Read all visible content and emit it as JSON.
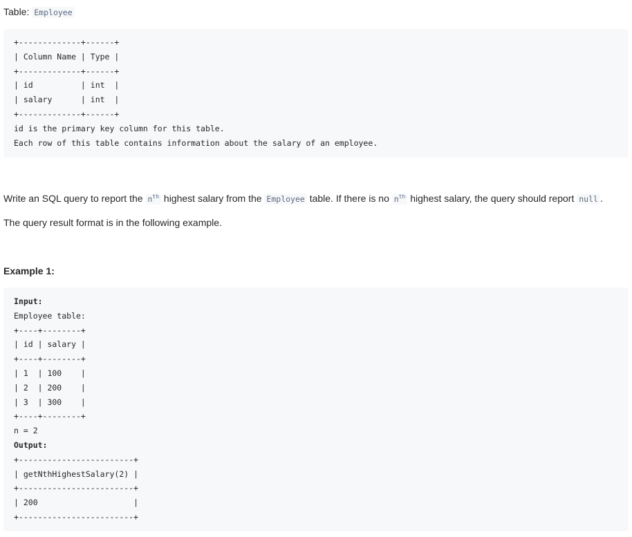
{
  "table_label": {
    "prefix": "Table: ",
    "name": "Employee"
  },
  "schema_block": {
    "lines": [
      "+-------------+------+",
      "| Column Name | Type |",
      "+-------------+------+",
      "| id          | int  |",
      "| salary      | int  |",
      "+-------------+------+",
      "id is the primary key column for this table.",
      "Each row of this table contains information about the salary of an employee."
    ]
  },
  "description": {
    "p1_a": "Write an SQL query to report the ",
    "n1": "n",
    "sup1": "th",
    "p1_b": " highest salary from the ",
    "table_code": "Employee",
    "p1_c": " table. If there is no ",
    "n2": "n",
    "sup2": "th",
    "p1_d": " highest salary, the query should report ",
    "null_code": "null",
    "p1_e": ".",
    "p2": "The query result format is in the following example."
  },
  "example": {
    "heading": "Example 1:",
    "input_label": "Input:",
    "input_lines": [
      "Employee table:",
      "+----+--------+",
      "| id | salary |",
      "+----+--------+",
      "| 1  | 100    |",
      "| 2  | 200    |",
      "| 3  | 300    |",
      "+----+--------+",
      "n = 2"
    ],
    "output_label": "Output:",
    "output_lines": [
      "+------------------------+",
      "| getNthHighestSalary(2) |",
      "+------------------------+",
      "| 200                    |",
      "+------------------------+"
    ]
  }
}
